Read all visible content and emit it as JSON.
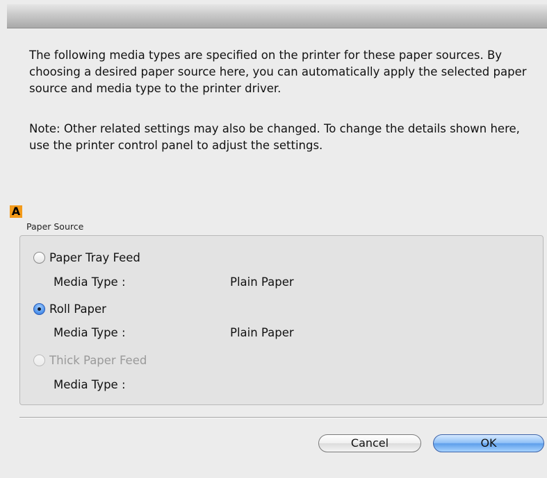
{
  "dialog": {
    "description": "The following media types are specified on the printer for these paper sources. By choosing a desired paper source here, you can automatically apply the selected paper source and media type to the printer driver.",
    "note": "Note: Other related settings may also be changed. To change the details shown here, use the printer control panel to adjust the settings."
  },
  "marker": {
    "label": "A",
    "color": "#f39a1a"
  },
  "paper_source": {
    "group_label": "Paper Source",
    "options": [
      {
        "label": "Paper Tray Feed",
        "media_type_label": "Media Type :",
        "media_type_value": "Plain Paper",
        "selected": false,
        "enabled": true
      },
      {
        "label": "Roll Paper",
        "media_type_label": "Media Type :",
        "media_type_value": "Plain Paper",
        "selected": true,
        "enabled": true
      },
      {
        "label": "Thick Paper Feed",
        "media_type_label": "Media Type :",
        "media_type_value": "",
        "selected": false,
        "enabled": false
      }
    ]
  },
  "buttons": {
    "cancel_label": "Cancel",
    "ok_label": "OK"
  },
  "colors": {
    "default_button_accent": "#5d9eea",
    "selected_radio": "#2d6fd6"
  }
}
